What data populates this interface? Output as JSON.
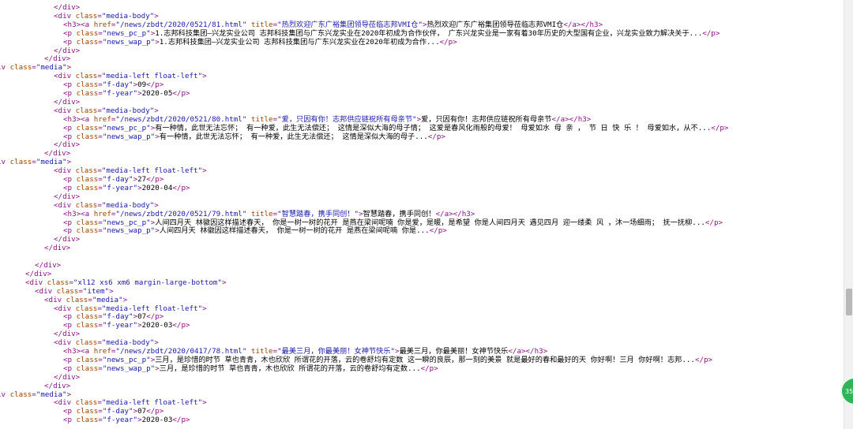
{
  "lines": [
    {
      "i": 68,
      "s": [
        [
          "tg",
          "</div>"
        ]
      ]
    },
    {
      "i": 68,
      "s": [
        [
          "tg",
          "<div "
        ],
        [
          "an",
          "class"
        ],
        [
          "tg",
          "="
        ],
        [
          "av",
          "\"media-body\""
        ],
        [
          "tg",
          ">"
        ]
      ]
    },
    {
      "i": 80,
      "s": [
        [
          "tg",
          "<h3><a "
        ],
        [
          "an",
          "href"
        ],
        [
          "tg",
          "="
        ],
        [
          "av",
          "\"/news/zbdt/2020/0521/81.html\""
        ],
        [
          "tg",
          " "
        ],
        [
          "an",
          "title"
        ],
        [
          "tg",
          "="
        ],
        [
          "av",
          "\"热烈欢迎广东广裕集团领导莅临志邦VMI仓\""
        ],
        [
          "tg",
          ">"
        ],
        [
          "tx",
          "热烈欢迎广东广裕集团领导莅临志邦VMI仓"
        ],
        [
          "tg",
          "</a></h3>"
        ]
      ]
    },
    {
      "i": 80,
      "s": [
        [
          "tg",
          "<p "
        ],
        [
          "an",
          "class"
        ],
        [
          "tg",
          "="
        ],
        [
          "av",
          "\"news_pc_p\""
        ],
        [
          "tg",
          ">"
        ],
        [
          "tx",
          "1.志邦科技集团—兴龙实业公司 志邦科技集团与广东兴龙实业在2020年初成为合作伙伴， 广东兴龙实业是一家有着30年历史的大型国有企业，兴龙实业致力解决关于..."
        ],
        [
          "tg",
          "</p>"
        ]
      ]
    },
    {
      "i": 80,
      "s": [
        [
          "tg",
          "<p "
        ],
        [
          "an",
          "class"
        ],
        [
          "tg",
          "="
        ],
        [
          "av",
          "\"news_wap_p\""
        ],
        [
          "tg",
          ">"
        ],
        [
          "tx",
          "1.志邦科技集团—兴龙实业公司 志邦科技集团与广东兴龙实业在2020年初成为合作..."
        ],
        [
          "tg",
          "</p>"
        ]
      ]
    },
    {
      "i": 68,
      "s": [
        [
          "tg",
          "</div>"
        ]
      ]
    },
    {
      "i": 56,
      "s": [
        [
          "tg",
          "</div>"
        ]
      ]
    },
    {
      "i": -4,
      "s": [
        [
          "tg",
          "iv "
        ],
        [
          "an",
          "class"
        ],
        [
          "tg",
          "="
        ],
        [
          "av",
          "\"media\""
        ],
        [
          "tg",
          ">"
        ]
      ]
    },
    {
      "i": 68,
      "s": [
        [
          "tg",
          "<div "
        ],
        [
          "an",
          "class"
        ],
        [
          "tg",
          "="
        ],
        [
          "av",
          "\"media-left float-left\""
        ],
        [
          "tg",
          ">"
        ]
      ]
    },
    {
      "i": 80,
      "s": [
        [
          "tg",
          "<p "
        ],
        [
          "an",
          "class"
        ],
        [
          "tg",
          "="
        ],
        [
          "av",
          "\"f-day\""
        ],
        [
          "tg",
          ">"
        ],
        [
          "tx",
          "09"
        ],
        [
          "tg",
          "</p>"
        ]
      ]
    },
    {
      "i": 80,
      "s": [
        [
          "tg",
          "<p "
        ],
        [
          "an",
          "class"
        ],
        [
          "tg",
          "="
        ],
        [
          "av",
          "\"f-year\""
        ],
        [
          "tg",
          ">"
        ],
        [
          "tx",
          "2020-05"
        ],
        [
          "tg",
          "</p>"
        ]
      ]
    },
    {
      "i": 68,
      "s": [
        [
          "tg",
          "</div>"
        ]
      ]
    },
    {
      "i": 68,
      "s": [
        [
          "tg",
          "<div "
        ],
        [
          "an",
          "class"
        ],
        [
          "tg",
          "="
        ],
        [
          "av",
          "\"media-body\""
        ],
        [
          "tg",
          ">"
        ]
      ]
    },
    {
      "i": 80,
      "s": [
        [
          "tg",
          "<h3><a "
        ],
        [
          "an",
          "href"
        ],
        [
          "tg",
          "="
        ],
        [
          "av",
          "\"/news/zbdt/2020/0521/80.html\""
        ],
        [
          "tg",
          " "
        ],
        [
          "an",
          "title"
        ],
        [
          "tg",
          "="
        ],
        [
          "av",
          "\"爱，只因有你！志邦供应链祝所有母亲节\""
        ],
        [
          "tg",
          ">"
        ],
        [
          "tx",
          "爱，只因有你！志邦供应链祝所有母亲节"
        ],
        [
          "tg",
          "</a></h3>"
        ]
      ]
    },
    {
      "i": 80,
      "s": [
        [
          "tg",
          "<p "
        ],
        [
          "an",
          "class"
        ],
        [
          "tg",
          "="
        ],
        [
          "av",
          "\"news_pc_p\""
        ],
        [
          "tg",
          ">"
        ],
        [
          "tx",
          "有一种情，此世无法忘怀； 有一种爱，此生无法偿还； 这情是深似大海的母子情； 这爱是春风化雨般的母爱！ 母爱如水 母 亲 ， 节 日 快 乐 ！ 母爱如水，从不..."
        ],
        [
          "tg",
          "</p>"
        ]
      ]
    },
    {
      "i": 80,
      "s": [
        [
          "tg",
          "<p "
        ],
        [
          "an",
          "class"
        ],
        [
          "tg",
          "="
        ],
        [
          "av",
          "\"news_wap_p\""
        ],
        [
          "tg",
          ">"
        ],
        [
          "tx",
          "有一种情，此世无法忘怀； 有一种爱，此生无法偿还； 这情是深似大海的母子..."
        ],
        [
          "tg",
          "</p>"
        ]
      ]
    },
    {
      "i": 68,
      "s": [
        [
          "tg",
          "</div>"
        ]
      ]
    },
    {
      "i": 56,
      "s": [
        [
          "tg",
          "</div>"
        ]
      ]
    },
    {
      "i": -4,
      "s": [
        [
          "tg",
          "iv "
        ],
        [
          "an",
          "class"
        ],
        [
          "tg",
          "="
        ],
        [
          "av",
          "\"media\""
        ],
        [
          "tg",
          ">"
        ]
      ]
    },
    {
      "i": 68,
      "s": [
        [
          "tg",
          "<div "
        ],
        [
          "an",
          "class"
        ],
        [
          "tg",
          "="
        ],
        [
          "av",
          "\"media-left float-left\""
        ],
        [
          "tg",
          ">"
        ]
      ]
    },
    {
      "i": 80,
      "s": [
        [
          "tg",
          "<p "
        ],
        [
          "an",
          "class"
        ],
        [
          "tg",
          "="
        ],
        [
          "av",
          "\"f-day\""
        ],
        [
          "tg",
          ">"
        ],
        [
          "tx",
          "27"
        ],
        [
          "tg",
          "</p>"
        ]
      ]
    },
    {
      "i": 80,
      "s": [
        [
          "tg",
          "<p "
        ],
        [
          "an",
          "class"
        ],
        [
          "tg",
          "="
        ],
        [
          "av",
          "\"f-year\""
        ],
        [
          "tg",
          ">"
        ],
        [
          "tx",
          "2020-04"
        ],
        [
          "tg",
          "</p>"
        ]
      ]
    },
    {
      "i": 68,
      "s": [
        [
          "tg",
          "</div>"
        ]
      ]
    },
    {
      "i": 68,
      "s": [
        [
          "tg",
          "<div "
        ],
        [
          "an",
          "class"
        ],
        [
          "tg",
          "="
        ],
        [
          "av",
          "\"media-body\""
        ],
        [
          "tg",
          ">"
        ]
      ]
    },
    {
      "i": 80,
      "s": [
        [
          "tg",
          "<h3><a "
        ],
        [
          "an",
          "href"
        ],
        [
          "tg",
          "="
        ],
        [
          "av",
          "\"/news/zbdt/2020/0521/79.html\""
        ],
        [
          "tg",
          " "
        ],
        [
          "an",
          "title"
        ],
        [
          "tg",
          "="
        ],
        [
          "av",
          "\"智慧踏春，携手同创！\""
        ],
        [
          "tg",
          ">"
        ],
        [
          "tx",
          "智慧踏春，携手同创！"
        ],
        [
          "tg",
          "</a></h3>"
        ]
      ]
    },
    {
      "i": 80,
      "s": [
        [
          "tg",
          "<p "
        ],
        [
          "an",
          "class"
        ],
        [
          "tg",
          "="
        ],
        [
          "av",
          "\"news_pc_p\""
        ],
        [
          "tg",
          ">"
        ],
        [
          "tx",
          "人间四月天 林徽因这样描述春天， 你是一树一树的花开 是燕在梁间呢喃 你是爱，是暖，是希望 你是人间四月天 遇见四月 迎一缕柔 风 ，沐一场细雨； 抚一抚柳..."
        ],
        [
          "tg",
          "</p>"
        ]
      ]
    },
    {
      "i": 80,
      "s": [
        [
          "tg",
          "<p "
        ],
        [
          "an",
          "class"
        ],
        [
          "tg",
          "="
        ],
        [
          "av",
          "\"news_wap_p\""
        ],
        [
          "tg",
          ">"
        ],
        [
          "tx",
          "人间四月天 林徽因这样描述春天， 你是一树一树的花开 是燕在梁间呢喃 你是..."
        ],
        [
          "tg",
          "</p>"
        ]
      ]
    },
    {
      "i": 68,
      "s": [
        [
          "tg",
          "</div>"
        ]
      ]
    },
    {
      "i": 56,
      "s": [
        [
          "tg",
          "</div>"
        ]
      ]
    },
    {
      "i": 56,
      "s": [
        [
          "tx",
          ""
        ]
      ]
    },
    {
      "i": 44,
      "s": [
        [
          "tg",
          "</div>"
        ]
      ]
    },
    {
      "i": 32,
      "s": [
        [
          "tg",
          "</div>"
        ]
      ]
    },
    {
      "i": 32,
      "s": [
        [
          "tg",
          "<div "
        ],
        [
          "an",
          "class"
        ],
        [
          "tg",
          "="
        ],
        [
          "av",
          "\"xl12 xs6 xm6 margin-large-bottom\""
        ],
        [
          "tg",
          ">"
        ]
      ]
    },
    {
      "i": 44,
      "s": [
        [
          "tg",
          "<div "
        ],
        [
          "an",
          "class"
        ],
        [
          "tg",
          "="
        ],
        [
          "av",
          "\"item\""
        ],
        [
          "tg",
          ">"
        ]
      ]
    },
    {
      "i": 56,
      "s": [
        [
          "tg",
          "<div "
        ],
        [
          "an",
          "class"
        ],
        [
          "tg",
          "="
        ],
        [
          "av",
          "\"media\""
        ],
        [
          "tg",
          ">"
        ]
      ]
    },
    {
      "i": 68,
      "s": [
        [
          "tg",
          "<div "
        ],
        [
          "an",
          "class"
        ],
        [
          "tg",
          "="
        ],
        [
          "av",
          "\"media-left float-left\""
        ],
        [
          "tg",
          ">"
        ]
      ]
    },
    {
      "i": 80,
      "s": [
        [
          "tg",
          "<p "
        ],
        [
          "an",
          "class"
        ],
        [
          "tg",
          "="
        ],
        [
          "av",
          "\"f-day\""
        ],
        [
          "tg",
          ">"
        ],
        [
          "tx",
          "07"
        ],
        [
          "tg",
          "</p>"
        ]
      ]
    },
    {
      "i": 80,
      "s": [
        [
          "tg",
          "<p "
        ],
        [
          "an",
          "class"
        ],
        [
          "tg",
          "="
        ],
        [
          "av",
          "\"f-year\""
        ],
        [
          "tg",
          ">"
        ],
        [
          "tx",
          "2020-03"
        ],
        [
          "tg",
          "</p>"
        ]
      ]
    },
    {
      "i": 68,
      "s": [
        [
          "tg",
          "</div>"
        ]
      ]
    },
    {
      "i": 68,
      "s": [
        [
          "tg",
          "<div "
        ],
        [
          "an",
          "class"
        ],
        [
          "tg",
          "="
        ],
        [
          "av",
          "\"media-body\""
        ],
        [
          "tg",
          ">"
        ]
      ]
    },
    {
      "i": 80,
      "s": [
        [
          "tg",
          "<h3><a "
        ],
        [
          "an",
          "href"
        ],
        [
          "tg",
          "="
        ],
        [
          "av",
          "\"/news/zbdt/2020/0417/78.html\""
        ],
        [
          "tg",
          " "
        ],
        [
          "an",
          "title"
        ],
        [
          "tg",
          "="
        ],
        [
          "av",
          "\"最美三月，你最美丽！女神节快乐\""
        ],
        [
          "tg",
          ">"
        ],
        [
          "tx",
          "最美三月，你最美丽！女神节快乐"
        ],
        [
          "tg",
          "</a></h3>"
        ]
      ]
    },
    {
      "i": 80,
      "s": [
        [
          "tg",
          "<p "
        ],
        [
          "an",
          "class"
        ],
        [
          "tg",
          "="
        ],
        [
          "av",
          "\"news_pc_p\""
        ],
        [
          "tg",
          ">"
        ],
        [
          "tx",
          "三月，是珍惜的时节 草也青青，木也欣欣 所谓花的开落，云的卷舒均有定数 这一瞬的良辰，那一刻的美景 就是最好的春和最好的天 你好啊！三月 你好啊！志邦..."
        ],
        [
          "tg",
          "</p>"
        ]
      ]
    },
    {
      "i": 80,
      "s": [
        [
          "tg",
          "<p "
        ],
        [
          "an",
          "class"
        ],
        [
          "tg",
          "="
        ],
        [
          "av",
          "\"news_wap_p\""
        ],
        [
          "tg",
          ">"
        ],
        [
          "tx",
          "三月，是珍惜的时节 草也青青，木也欣欣 所谓花的开落，云的卷舒均有定数..."
        ],
        [
          "tg",
          "</p>"
        ]
      ]
    },
    {
      "i": 68,
      "s": [
        [
          "tg",
          "</div>"
        ]
      ]
    },
    {
      "i": 56,
      "s": [
        [
          "tg",
          "</div>"
        ]
      ]
    },
    {
      "i": -4,
      "s": [
        [
          "tg",
          "iv "
        ],
        [
          "an",
          "class"
        ],
        [
          "tg",
          "="
        ],
        [
          "av",
          "\"media\""
        ],
        [
          "tg",
          ">"
        ]
      ]
    },
    {
      "i": 68,
      "s": [
        [
          "tg",
          "<div "
        ],
        [
          "an",
          "class"
        ],
        [
          "tg",
          "="
        ],
        [
          "av",
          "\"media-left float-left\""
        ],
        [
          "tg",
          ">"
        ]
      ]
    },
    {
      "i": 80,
      "s": [
        [
          "tg",
          "<p "
        ],
        [
          "an",
          "class"
        ],
        [
          "tg",
          "="
        ],
        [
          "av",
          "\"f-day\""
        ],
        [
          "tg",
          ">"
        ],
        [
          "tx",
          "07"
        ],
        [
          "tg",
          "</p>"
        ]
      ]
    },
    {
      "i": 80,
      "s": [
        [
          "tg",
          "<p "
        ],
        [
          "an",
          "class"
        ],
        [
          "tg",
          "="
        ],
        [
          "av",
          "\"f-year\""
        ],
        [
          "tg",
          ">"
        ],
        [
          "tx",
          "2020-03"
        ],
        [
          "tg",
          "</p>"
        ]
      ]
    }
  ],
  "badge": {
    "text": "35"
  },
  "colors": {
    "tag": "#881280",
    "attr_name": "#994500",
    "attr_value": "#1a1aa6",
    "text": "#000000",
    "badge": "#2fb457"
  }
}
